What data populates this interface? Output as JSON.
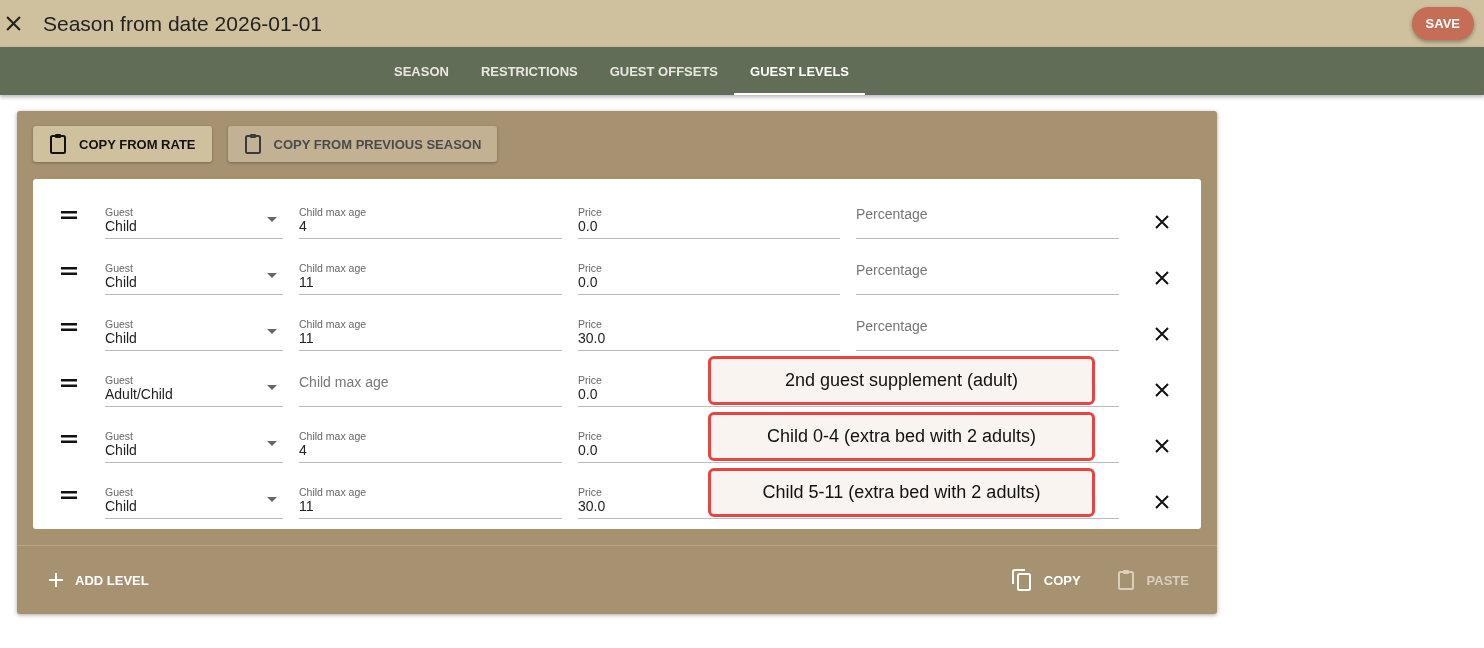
{
  "header": {
    "title": "Season from date 2026-01-01",
    "save_label": "SAVE"
  },
  "tabs": [
    {
      "label": "SEASON",
      "selected": false
    },
    {
      "label": "RESTRICTIONS",
      "selected": false
    },
    {
      "label": "GUEST OFFSETS",
      "selected": false
    },
    {
      "label": "GUEST LEVELS",
      "selected": true
    }
  ],
  "toolbar": [
    {
      "label": "COPY FROM RATE",
      "disabled": false
    },
    {
      "label": "COPY FROM PREVIOUS SEASON",
      "disabled": true
    }
  ],
  "levels": [
    {
      "guest_label": "Guest",
      "guest": "Child",
      "age_label": "Child max age",
      "age": "4",
      "price_label": "Price",
      "price": "0.0",
      "percentage_placeholder": "Percentage"
    },
    {
      "guest_label": "Guest",
      "guest": "Child",
      "age_label": "Child max age",
      "age": "11",
      "price_label": "Price",
      "price": "0.0",
      "percentage_placeholder": "Percentage"
    },
    {
      "guest_label": "Guest",
      "guest": "Child",
      "age_label": "Child max age",
      "age": "11",
      "price_label": "Price",
      "price": "30.0",
      "percentage_placeholder": "Percentage"
    },
    {
      "guest_label": "Guest",
      "guest": "Adult/Child",
      "age_placeholder": "Child max age",
      "price_label": "Price",
      "price": "0.0",
      "note": "2nd guest supplement (adult)"
    },
    {
      "guest_label": "Guest",
      "guest": "Child",
      "age_label": "Child max age",
      "age": "4",
      "price_label": "Price",
      "price": "0.0",
      "note": "Child 0-4 (extra bed with 2 adults)"
    },
    {
      "guest_label": "Guest",
      "guest": "Child",
      "age_label": "Child max age",
      "age": "11",
      "price_label": "Price",
      "price": "30.0",
      "note": "Child 5-11 (extra bed with 2 adults)"
    }
  ],
  "footer": {
    "add_label": "ADD LEVEL",
    "actions": [
      {
        "label": "COPY",
        "kind": "copy",
        "disabled": false
      },
      {
        "label": "PASTE",
        "kind": "paste",
        "disabled": true
      }
    ]
  }
}
